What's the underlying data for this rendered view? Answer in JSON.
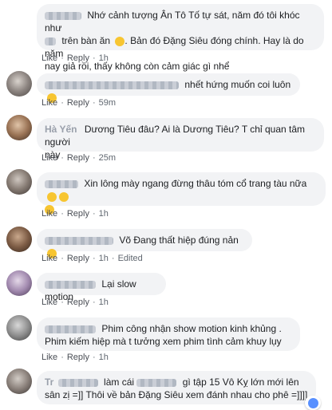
{
  "comments": [
    {
      "name_hidden": true,
      "text_line1": "Nhớ cảnh tượng Ân Tô Tố tự sát, năm đó tôi khóc như",
      "text_line2": "trên bàn ăn",
      "text_line2b": "Bản đó Đặng Siêu đóng chính. Hay là do năm",
      "text_line3": "nay giả rồi, thấy không còn cảm giác gì nhể",
      "like": "Like",
      "reply": "Reply",
      "time": "1h"
    },
    {
      "name_hidden": true,
      "text": "nhết hứng muốn coi luôn",
      "like": "Like",
      "reply": "Reply",
      "time": "59m"
    },
    {
      "name_visible": "Hà Yến",
      "text_line1": "Dương Tiêu đâu? Ai là Dương Tiêu? T chỉ quan tâm người",
      "text_line2": "này",
      "like": "Like",
      "reply": "Reply",
      "time": "25m"
    },
    {
      "name_hidden": true,
      "text": "Xin lông mày ngang đừng thâu tóm cổ trang tàu nữa",
      "like": "Like",
      "reply": "Reply",
      "time": "1h"
    },
    {
      "name_hidden": true,
      "text": "Võ Đang thất hiệp đúng nản",
      "like": "Like",
      "reply": "Reply",
      "time": "1h",
      "edited": "Edited"
    },
    {
      "name_hidden": true,
      "text": "Lại slow motion",
      "like": "Like",
      "reply": "Reply",
      "time": "1h"
    },
    {
      "name_hidden": true,
      "text_line1": "Phim công nhận show motion kinh khủng .",
      "text_line2": "Phim kiếm hiệp mà t tưởng xem phim tình cảm khuy lụy",
      "like": "Like",
      "reply": "Reply",
      "time": "1h"
    },
    {
      "name_visible": "Tr",
      "text_line1a": "làm cái",
      "text_line1b": "gì tập 15 Vô Kỵ lớn mới lên",
      "text_line2": "sân zị =]] Thôi về bản Đặng Siêu xem đánh nhau cho phê =]]]]"
    }
  ],
  "colors": {
    "bubble": "#f2f3f5",
    "link": "#4b4f56",
    "name": "#385898",
    "reaction": "#5890ff"
  }
}
